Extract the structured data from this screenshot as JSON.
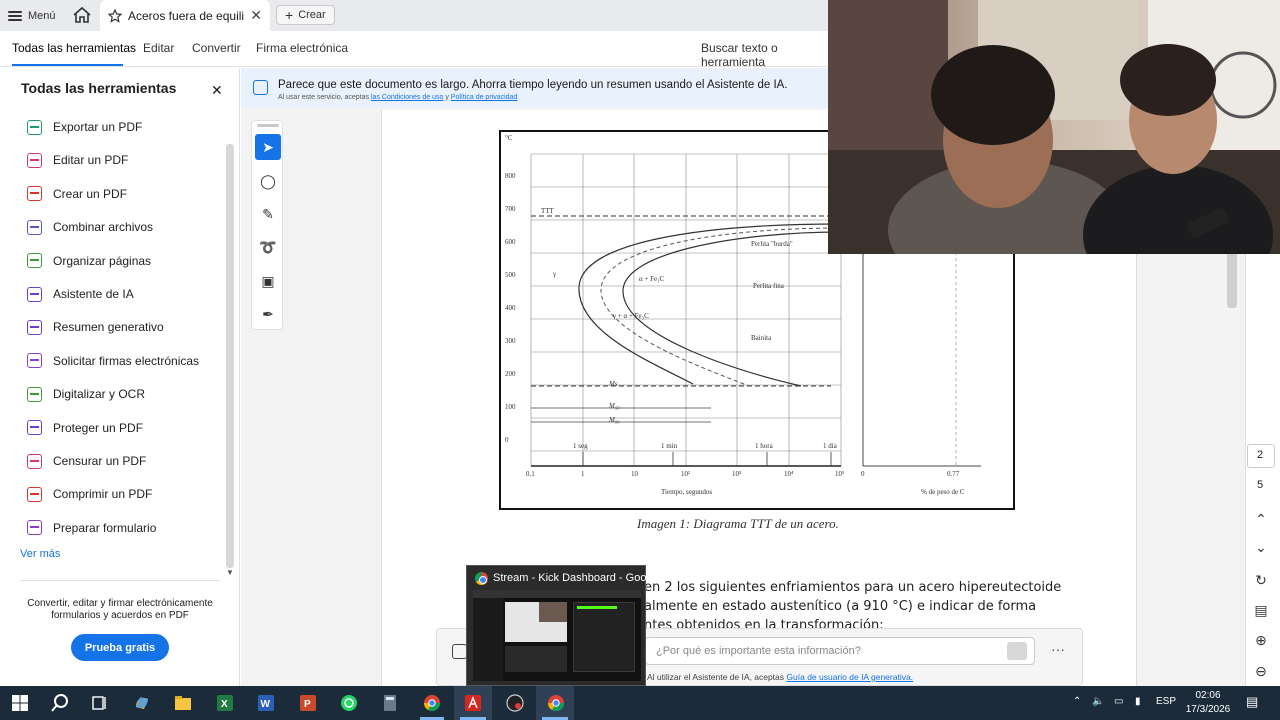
{
  "tabbar": {
    "menu_label": "Menú",
    "tab_title": "Aceros fuera de equili...",
    "new_label": "Crear"
  },
  "toolbar": {
    "tabs": [
      "Todas las herramientas",
      "Editar",
      "Convertir",
      "Firma electrónica"
    ],
    "search_label": "Buscar texto o herramienta"
  },
  "left_panel": {
    "title": "Todas las herramientas",
    "items": [
      {
        "label": "Exportar un PDF",
        "color": "#1f9a67"
      },
      {
        "label": "Editar un PDF",
        "color": "#d4386b"
      },
      {
        "label": "Crear un PDF",
        "color": "#d9332a"
      },
      {
        "label": "Combinar archivos",
        "color": "#5a55c8"
      },
      {
        "label": "Organizar páginas",
        "color": "#3c9c3c"
      },
      {
        "label": "Asistente de IA",
        "color": "#6a3fd0"
      },
      {
        "label": "Resumen generativo",
        "color": "#6a3fd0"
      },
      {
        "label": "Solicitar firmas electrónicas",
        "color": "#8a3fc4"
      },
      {
        "label": "Digitalizar y OCR",
        "color": "#3c9c3c"
      },
      {
        "label": "Proteger un PDF",
        "color": "#6a3fd0"
      },
      {
        "label": "Censurar un PDF",
        "color": "#d4386b"
      },
      {
        "label": "Comprimir un PDF",
        "color": "#d9332a"
      },
      {
        "label": "Preparar formulario",
        "color": "#8a3fc4"
      }
    ],
    "more_label": "Ver más",
    "promo_text": "Convertir, editar y firmar electrónicamente formularios y acuerdos en PDF",
    "trial_button": "Prueba gratis"
  },
  "ai_banner": {
    "text": "Parece que este documento es largo. Ahorra tiempo leyendo un resumen usando el Asistente de IA.",
    "sub_prefix": "Al usar este servicio, aceptas",
    "sub_link1": "las Condiciones de uso",
    "sub_and": "y",
    "sub_link2": "Política de privacidad"
  },
  "document": {
    "caption": "Imagen 1: Diagrama TTT de un acero.",
    "body_lines": [
      "en 2 los siguientes enfriamientos para un acero hipereutectoide",
      "almente en estado austenítico (a 910 °C) e indicar de forma",
      "ntes obtenidos en la transformación:"
    ]
  },
  "ttt_figure": {
    "y_ticks": [
      "°C",
      "800",
      "700",
      "600",
      "500",
      "400",
      "300",
      "200",
      "100",
      "0"
    ],
    "x_ticks": [
      "0.1",
      "1",
      "10",
      "10²",
      "10³",
      "10⁴",
      "10⁵"
    ],
    "x_label": "Tiempo, segundos",
    "time_marks": [
      "1 seg",
      "1 min",
      "1 hora",
      "1 día"
    ],
    "labels": [
      "TTT",
      "Perlita \"burda\"",
      "Perlita fina",
      "Bainita",
      "α + Fe₃C",
      "γ + α + Fe₃C",
      "γ",
      "Ms",
      "M₅₀",
      "M₉₀"
    ],
    "right_x_ticks": [
      "0",
      "0.77"
    ],
    "right_x_label": "% de peso de C"
  },
  "ai_input": {
    "placeholder": "¿Por qué es importante esta información?",
    "footer_prefix": "Al utilizar el Asistente de IA, aceptas",
    "footer_link": "Guía de usuario de IA generativa."
  },
  "right_rail": {
    "current_page": "2",
    "total_pages": "5"
  },
  "thumbnail": {
    "title": "Stream - Kick Dashboard - Goo..."
  },
  "taskbar": {
    "language": "ESP",
    "time": "02:06",
    "date": "17/3/2026"
  }
}
